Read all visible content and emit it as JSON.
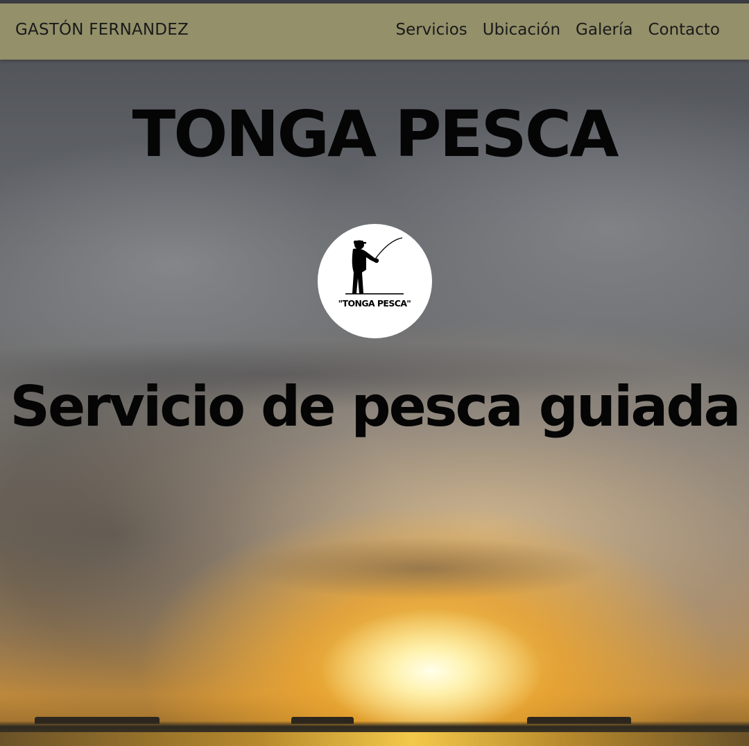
{
  "navbar": {
    "brand": "GASTÓN FERNANDEZ",
    "links": [
      {
        "label": "Servicios"
      },
      {
        "label": "Ubicación"
      },
      {
        "label": "Galería"
      },
      {
        "label": "Contacto"
      }
    ]
  },
  "hero": {
    "title": "TONGA PESCA",
    "logo_text": "\"TONGA PESCA\"",
    "logo_icon": "fisherman-silhouette-icon",
    "subtitle": "Servicio de pesca guiada"
  },
  "colors": {
    "navbar_bg": "#93906a",
    "text": "#050505",
    "logo_bg": "#ffffff"
  }
}
